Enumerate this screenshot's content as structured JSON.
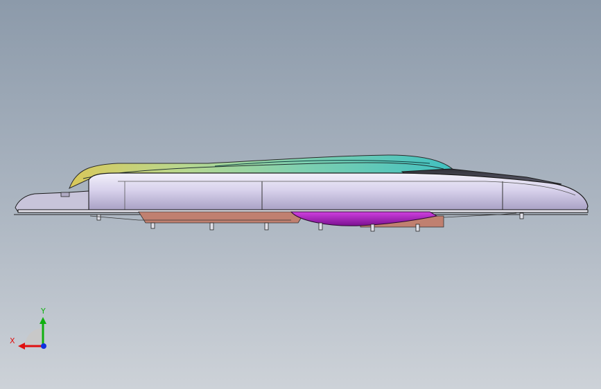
{
  "viewport": {
    "view_name": "graphics-area",
    "background_top": "#8c9aaa",
    "background_bottom": "#cdd2d8"
  },
  "triad": {
    "x_label": "X",
    "y_label": "Y",
    "x_color": "#e01010",
    "y_color": "#10b010",
    "z_color": "#1030e0"
  },
  "model": {
    "icon": "cad-assembly-side-view",
    "shell_color": "#d6d0ea",
    "lens_colors": [
      "#d9c85a",
      "#7fd0b0",
      "#40c0c0"
    ],
    "inner_parts_color": "#c08070",
    "bulb_color": "#b020c0"
  }
}
